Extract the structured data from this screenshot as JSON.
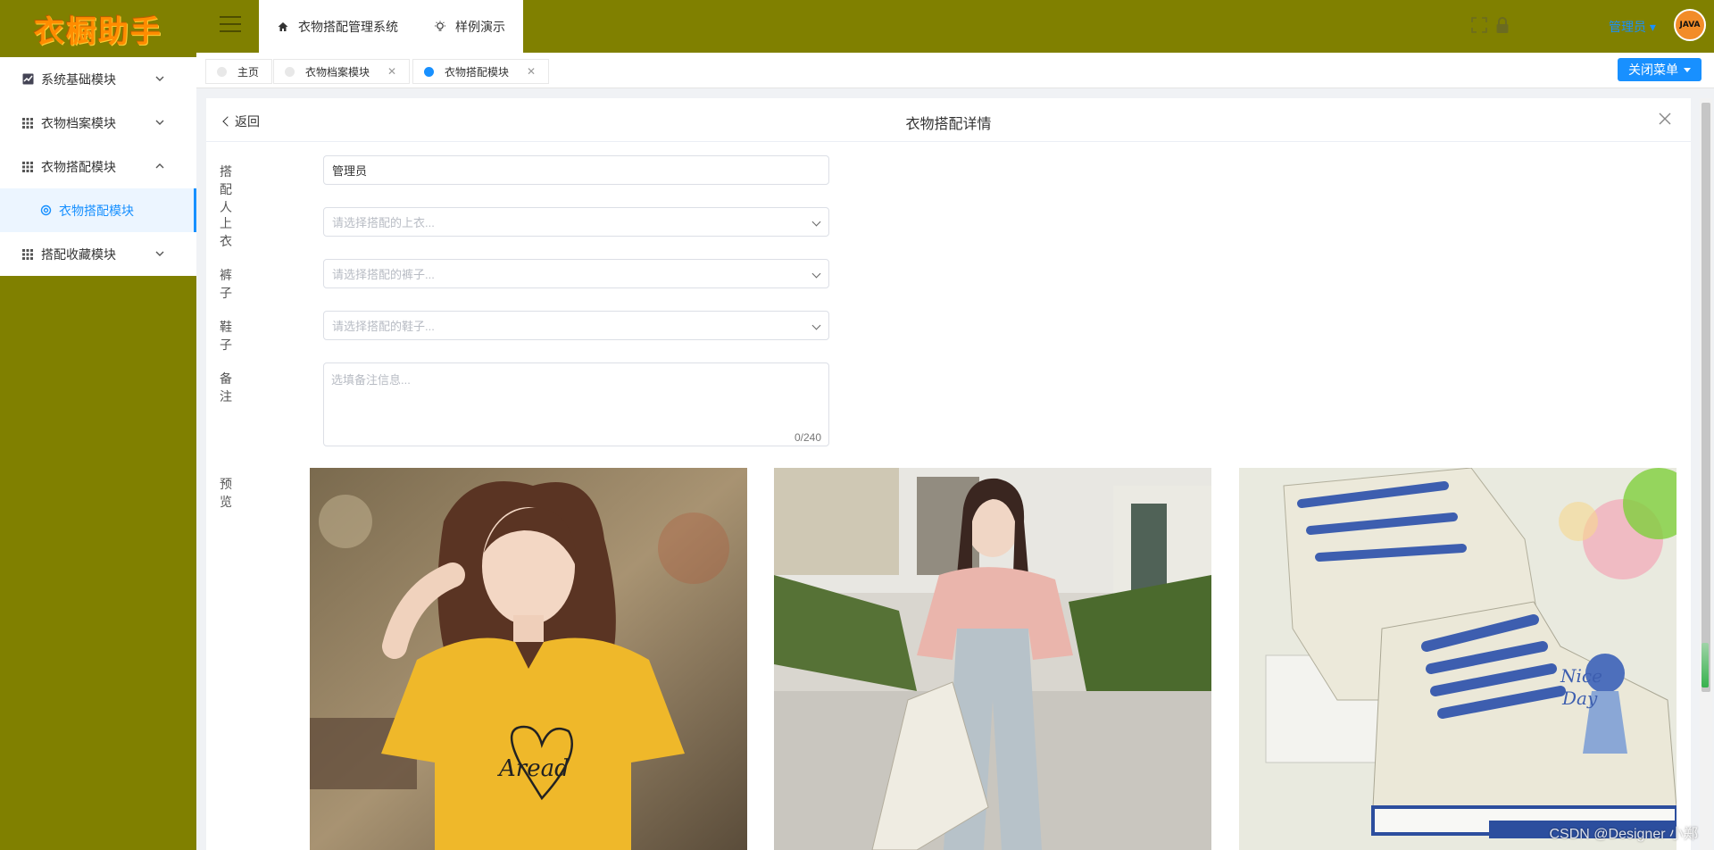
{
  "logo": {
    "text": "衣橱助手"
  },
  "sidebar": {
    "items": [
      {
        "label": "系统基础模块",
        "icon": "chart-icon",
        "expanded": false
      },
      {
        "label": "衣物档案模块",
        "icon": "grid-icon",
        "expanded": false
      },
      {
        "label": "衣物搭配模块",
        "icon": "grid-icon",
        "expanded": true
      },
      {
        "label": "衣物搭配模块",
        "icon": "gear-icon",
        "sub": true,
        "active": true
      },
      {
        "label": "搭配收藏模块",
        "icon": "grid-icon",
        "expanded": false
      }
    ]
  },
  "header": {
    "tabs": [
      {
        "label": "衣物搭配管理系统",
        "icon": "home-icon"
      },
      {
        "label": "样例演示",
        "icon": "bulb-icon"
      }
    ],
    "user": "管理员",
    "avatar_text": "JAVA"
  },
  "tags": [
    {
      "label": "主页",
      "closable": false,
      "active": false
    },
    {
      "label": "衣物档案模块",
      "closable": true,
      "active": false
    },
    {
      "label": "衣物搭配模块",
      "closable": true,
      "active": true
    }
  ],
  "close_menu_label": "关闭菜单",
  "detail": {
    "back_label": "返回",
    "title": "衣物搭配详情",
    "matcher_label": "搭配人",
    "matcher_value": "管理员",
    "top_label": "上衣",
    "top_placeholder": "请选择搭配的上衣...",
    "pants_label": "裤子",
    "pants_placeholder": "请选择搭配的裤子...",
    "shoes_label": "鞋子",
    "shoes_placeholder": "请选择搭配的鞋子...",
    "remark_label": "备注",
    "remark_placeholder": "选填备注信息...",
    "remark_count": "0/240",
    "preview_label": "预览"
  },
  "colors": {
    "olive": "#808000",
    "accent": "#1890ff",
    "logo": "#ff8c00"
  },
  "watermark": "CSDN @Designer 小郑"
}
